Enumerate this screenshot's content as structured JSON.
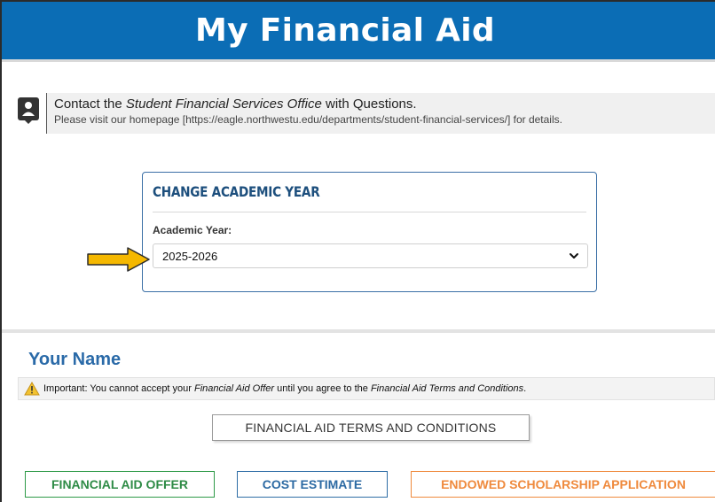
{
  "header": {
    "title": "My Financial Aid",
    "color": "#0b6db5"
  },
  "contact": {
    "line1_prefix": "Contact the ",
    "line1_office": "Student Financial Services Office",
    "line1_suffix": " with Questions.",
    "line2": "Please visit our homepage [https://eagle.northwestu.edu/departments/student-financial-services/] for details.",
    "icon": "contact-card-icon"
  },
  "academic_year": {
    "card_title": "CHANGE ACADEMIC YEAR",
    "label": "Academic Year:",
    "selected": "2025-2026",
    "pointer_color": "#f5b800"
  },
  "student": {
    "name": "Your Name"
  },
  "notice": {
    "prefix": "Important: You cannot accept your ",
    "offer_term": "Financial Aid Offer",
    "middle": " until you agree to the ",
    "terms_term": "Financial Aid Terms and Conditions",
    "suffix": "."
  },
  "buttons": {
    "terms": "FINANCIAL AID TERMS AND CONDITIONS",
    "offer": "FINANCIAL AID OFFER",
    "cost": "COST ESTIMATE",
    "endowed": "ENDOWED SCHOLARSHIP APPLICATION"
  },
  "colors": {
    "offer": "#2e9a48",
    "cost": "#2f6ea6",
    "endowed": "#ef8a3d"
  }
}
